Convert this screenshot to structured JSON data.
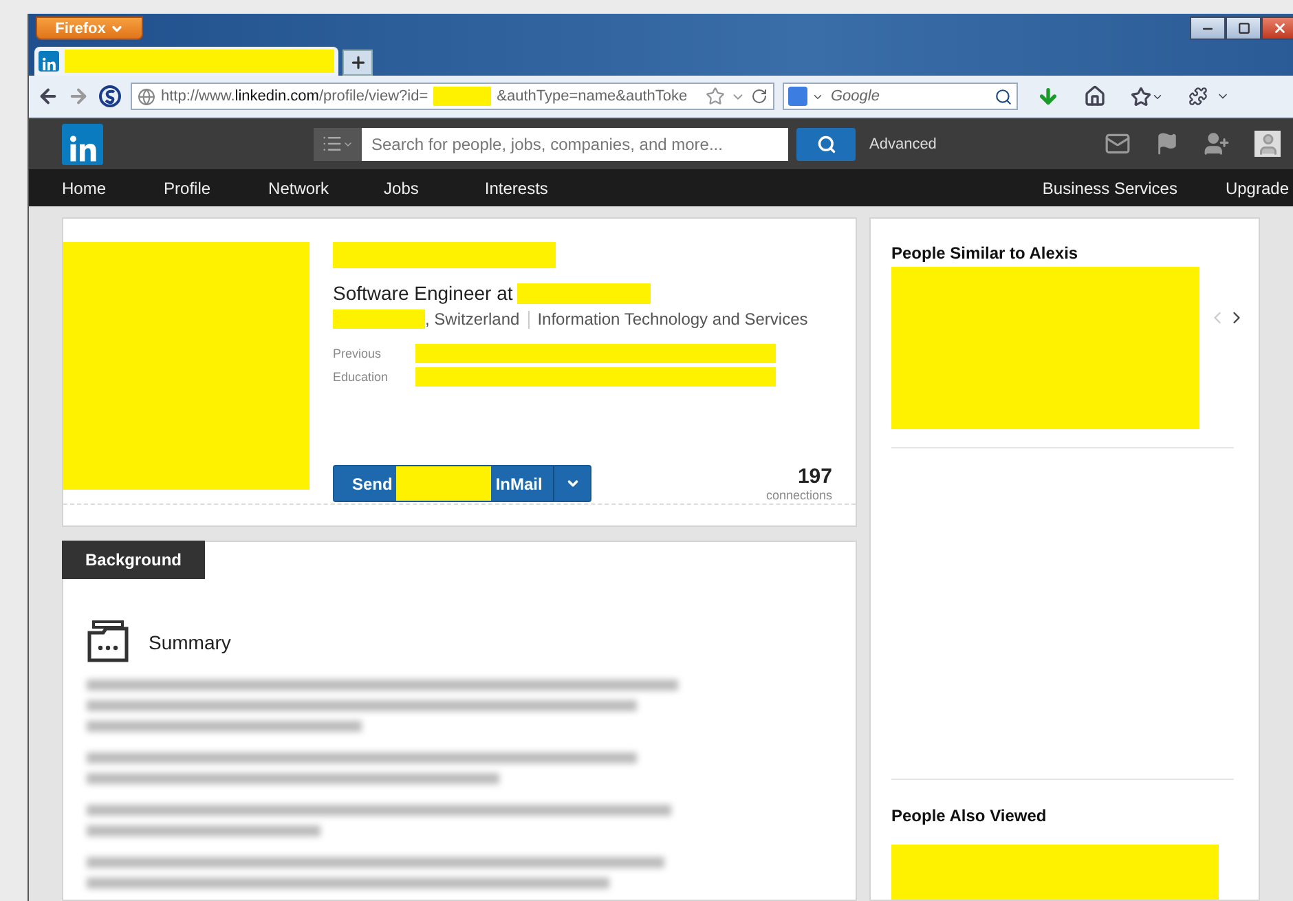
{
  "browser": {
    "menu_button": "Firefox",
    "url": {
      "prefix": "http://www.",
      "domain": "linkedin.com",
      "path": "/profile/view?id=",
      "suffix": "&authType=name&authToke"
    },
    "search_placeholder": "Google"
  },
  "linkedin": {
    "search_placeholder": "Search for people, jobs, companies, and more...",
    "advanced": "Advanced",
    "nav": [
      {
        "label": "Home"
      },
      {
        "label": "Profile"
      },
      {
        "label": "Network"
      },
      {
        "label": "Jobs"
      },
      {
        "label": "Interests"
      }
    ],
    "nav_right": [
      {
        "label": "Business Services"
      },
      {
        "label": "Upgrade"
      }
    ]
  },
  "profile": {
    "title_prefix": "Software Engineer at",
    "location": ", Switzerland",
    "industry": "Information Technology and Services",
    "details": [
      {
        "label": "Previous"
      },
      {
        "label": "Education"
      }
    ],
    "send_button": {
      "before": "Send",
      "after": "InMail"
    },
    "connections_count": "197",
    "connections_label": "connections"
  },
  "background": {
    "tab": "Background",
    "section_title": "Summary"
  },
  "sidebar": {
    "similar_title": "People Similar to Alexis",
    "carousel": {
      "prev_disabled": true,
      "next_disabled": false
    },
    "also_viewed_title": "People Also Viewed"
  }
}
